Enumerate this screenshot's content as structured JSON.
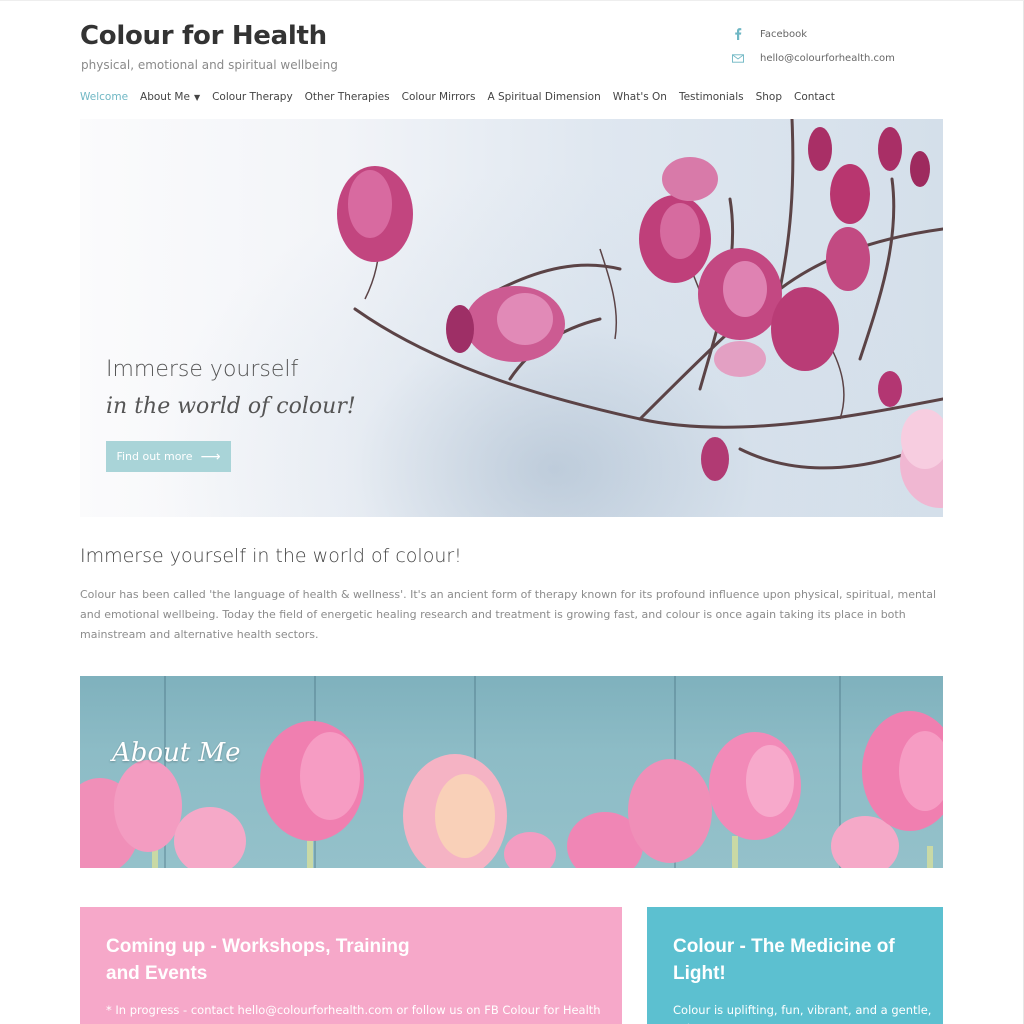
{
  "site": {
    "title": "Colour for Health",
    "tagline": "physical, emotional and spiritual wellbeing"
  },
  "contact": {
    "facebook_label": "Facebook",
    "email": "hello@colourforhealth.com",
    "facebook_icon": "facebook-icon",
    "mail_icon": "envelope-icon"
  },
  "nav": {
    "items": [
      {
        "label": "Welcome",
        "active": true
      },
      {
        "label": "About Me",
        "dropdown": true
      },
      {
        "label": "Colour Therapy"
      },
      {
        "label": "Other Therapies"
      },
      {
        "label": "Colour Mirrors"
      },
      {
        "label": "A Spiritual Dimension"
      },
      {
        "label": "What's On"
      },
      {
        "label": "Testimonials"
      },
      {
        "label": "Shop"
      },
      {
        "label": "Contact"
      }
    ]
  },
  "hero": {
    "line1": "Immerse yourself",
    "line2": "in the world of colour!",
    "button_label": "Find out more",
    "button_icon": "arrow-right-icon"
  },
  "intro": {
    "heading": "Immerse yourself in the world of colour!",
    "body": "Colour has been called 'the language of health & wellness'. It's an ancient form of therapy known for its profound influence upon physical, spiritual, mental and emotional wellbeing. Today the field of energetic healing research and treatment is growing fast, and colour is once again taking its place in both mainstream and alternative health sectors."
  },
  "about": {
    "title": "About Me"
  },
  "cards": [
    {
      "title": "Coming up - Workshops, Training and Events",
      "text": "* In progress - contact hello@colourforhealth.com or follow us on FB Colour for Health"
    },
    {
      "title": "Colour - The Medicine of Light!",
      "text": "Colour is uplifting, fun, vibrant, and a gentle, yet"
    }
  ],
  "colors": {
    "accent": "#6fb7c4",
    "button": "#a9d4d8",
    "pink_card": "#f6a8c9",
    "blue_card": "#5cc0d0"
  }
}
